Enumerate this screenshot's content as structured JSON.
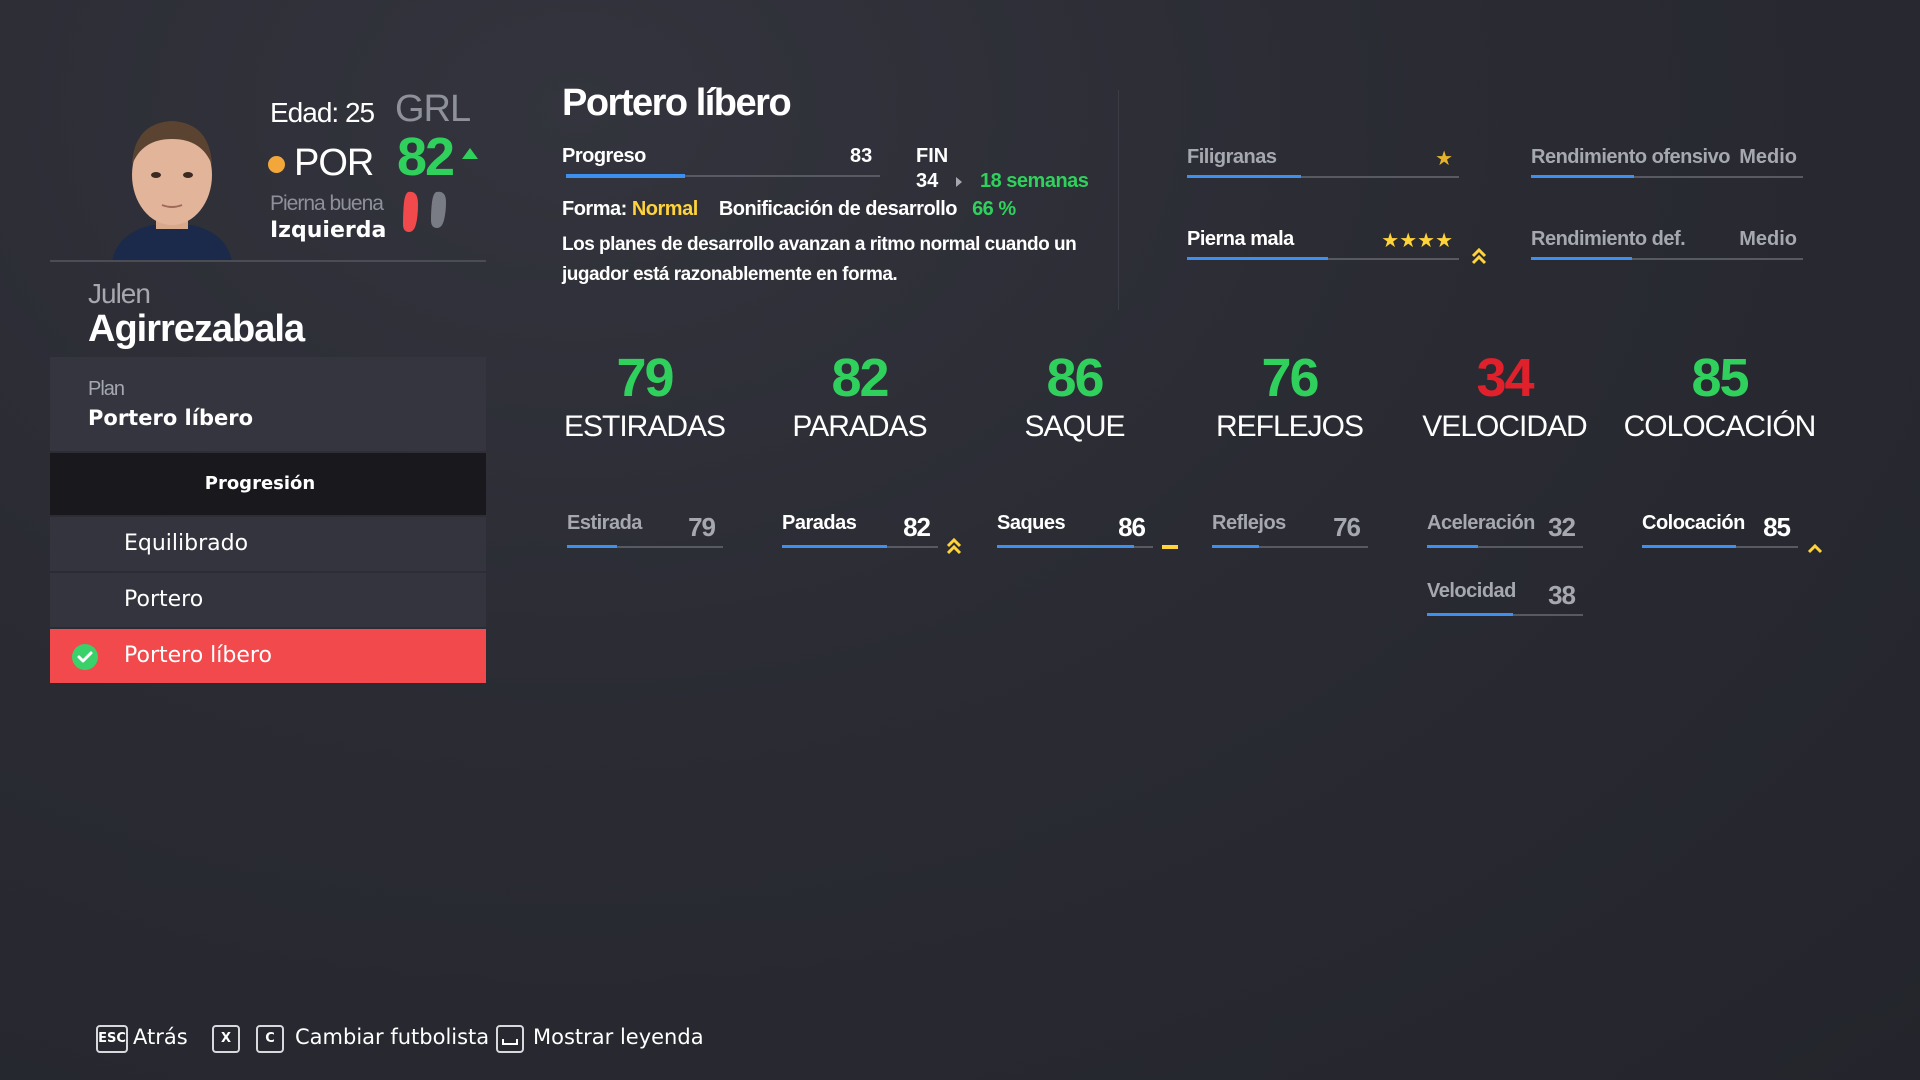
{
  "player": {
    "age_line": "Edad: 25",
    "position": "POR",
    "position_color": "#f3a73a",
    "overall_label": "GRL",
    "overall": "82",
    "preferred_foot_title": "Pierna buena",
    "preferred_foot": "Izquierda",
    "first_name": "Julen",
    "last_name": "Agirrezabala"
  },
  "plan": {
    "title": "Plan",
    "value": "Portero líbero",
    "progression_header": "Progresión",
    "options": [
      {
        "label": "Equilibrado",
        "selected": false
      },
      {
        "label": "Portero",
        "selected": false
      },
      {
        "label": "Portero líbero",
        "selected": true
      }
    ]
  },
  "header": {
    "plan_heading": "Portero líbero",
    "progress_label": "Progreso",
    "progress_value": "83",
    "progress_fraction": 0.38,
    "fin_label": "FIN",
    "fin_value": "34",
    "fin_weeks": "18 semanas",
    "form_label": "Forma:",
    "form_value": "Normal",
    "bonus_label": "Bonificación de desarrollo",
    "bonus_value": "66 %",
    "description": "Los planes de desarrollo avanzan a ritmo normal cuando un jugador está razonablemente en forma."
  },
  "traits": {
    "skill_moves": {
      "label": "Filigranas",
      "stars": "★",
      "fill": 0.42
    },
    "weak_foot": {
      "label": "Pierna mala",
      "stars": "★★★★",
      "fill": 0.52
    },
    "attacking_wr": {
      "label": "Rendimiento ofensivo",
      "value": "Medio",
      "fill": 0.38
    },
    "defensive_wr": {
      "label": "Rendimiento def.",
      "value": "Medio",
      "fill": 0.37
    }
  },
  "categories": [
    {
      "value": "79",
      "label": "ESTIRADAS"
    },
    {
      "value": "82",
      "label": "PARADAS"
    },
    {
      "value": "86",
      "label": "SAQUE"
    },
    {
      "value": "76",
      "label": "REFLEJOS"
    },
    {
      "value": "34",
      "label": "VELOCIDAD"
    },
    {
      "value": "85",
      "label": "COLOCACIÓN"
    }
  ],
  "attributes": {
    "estirada": {
      "label": "Estirada",
      "value": "79",
      "fill": 0.32
    },
    "paradas": {
      "label": "Paradas",
      "value": "82",
      "fill": 0.67
    },
    "saques": {
      "label": "Saques",
      "value": "86",
      "fill": 0.88
    },
    "reflejos": {
      "label": "Reflejos",
      "value": "76",
      "fill": 0.3
    },
    "aceleracion": {
      "label": "Aceleración",
      "value": "32",
      "fill": 0.33
    },
    "colocacion": {
      "label": "Colocación",
      "value": "85",
      "fill": 0.6
    },
    "velocidad": {
      "label": "Velocidad",
      "value": "38",
      "fill": 0.55
    }
  },
  "colors": {
    "green": "#2fd15c",
    "red": "#e0202a",
    "accent": "#f2494d",
    "gold": "#ffd33a",
    "bar_blue": "#3d8ff0"
  },
  "footer": {
    "esc_key": "ESC",
    "back": "Atrás",
    "x_key": "X",
    "c_key": "C",
    "change_player": "Cambiar futbolista",
    "show_legend": "Mostrar leyenda"
  }
}
